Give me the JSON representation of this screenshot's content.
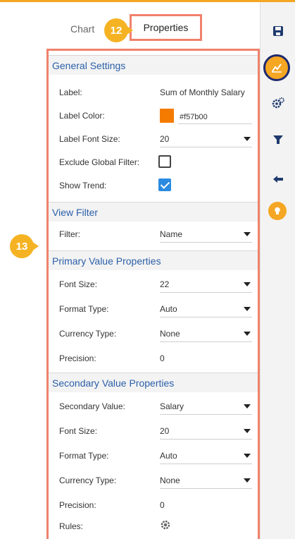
{
  "tabs": {
    "chart_label": "Chart",
    "properties_label": "Properties",
    "callout_12": "12",
    "callout_13": "13"
  },
  "sections": [
    {
      "title": "General Settings",
      "rows": [
        {
          "label": "Label:",
          "value": "Sum of Monthly Salary"
        },
        {
          "label": "Label Color:",
          "value": "#f57b00"
        },
        {
          "label": "Label Font Size:",
          "value": "20"
        },
        {
          "label": "Exclude Global Filter:",
          "checked": false
        },
        {
          "label": "Show Trend:",
          "checked": true
        }
      ]
    },
    {
      "title": "View Filter",
      "rows": [
        {
          "label": "Filter:",
          "value": "Name"
        }
      ]
    },
    {
      "title": "Primary Value Properties",
      "rows": [
        {
          "label": "Font Size:",
          "value": "22"
        },
        {
          "label": "Format Type:",
          "value": "Auto"
        },
        {
          "label": "Currency Type:",
          "value": "None"
        },
        {
          "label": "Precision:",
          "value": "0"
        }
      ]
    },
    {
      "title": "Secondary Value Properties",
      "rows": [
        {
          "label": "Secondary Value:",
          "value": "Salary"
        },
        {
          "label": "Font Size:",
          "value": "20"
        },
        {
          "label": "Format Type:",
          "value": "Auto"
        },
        {
          "label": "Currency Type:",
          "value": "None"
        },
        {
          "label": "Precision:",
          "value": "0"
        },
        {
          "label": "Rules:"
        }
      ]
    }
  ],
  "toolbar": {
    "icons": [
      "save-icon",
      "chart-icon",
      "settings-icon",
      "filter-icon",
      "back-arrow-icon",
      "bulb-icon"
    ]
  },
  "colors": {
    "accent": "#f5a623",
    "highlight_border": "#f0816b",
    "section_title": "#2b5fa8",
    "checkbox_on": "#2b8be0",
    "label_color_swatch": "#f57b00"
  }
}
